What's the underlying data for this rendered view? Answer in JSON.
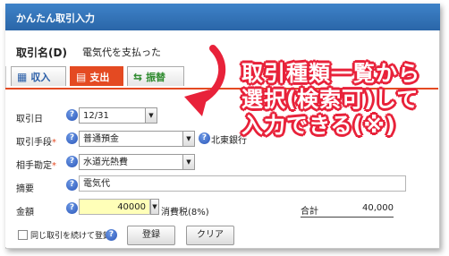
{
  "window": {
    "title": "かんたん取引入力"
  },
  "name_row": {
    "label": "取引名(D)",
    "value": "電気代を支払った"
  },
  "tabs": [
    {
      "label": "収入",
      "icon": "income-icon"
    },
    {
      "label": "支出",
      "icon": "expense-icon"
    },
    {
      "label": "振替",
      "icon": "transfer-icon"
    }
  ],
  "partial_tab_text": "支出",
  "form": {
    "date_label": "取引日",
    "date_value": "12/31",
    "method_label": "取引手段",
    "method_value": "普通預金",
    "bank_value": "北東銀行",
    "account_label": "相手勘定",
    "account_value": "水道光熱費",
    "memo_label": "摘要",
    "memo_value": "電気代",
    "amount_label": "金額",
    "amount_value": "40000",
    "tax_label": "消費税(8%)",
    "total_label": "合計",
    "total_value": "40,000",
    "required_mark": "*"
  },
  "footer": {
    "repeat_label": "同じ取引を続けて登録",
    "register_button": "登録",
    "clear_button": "クリア"
  },
  "callout": {
    "line1": "取引種類一覧から",
    "line2": "選択(検索可)して",
    "line3": "入力できる(※)"
  },
  "colors": {
    "accent": "#e44a22",
    "callout": "#e8223a",
    "title_bar": "#2a66a8"
  }
}
